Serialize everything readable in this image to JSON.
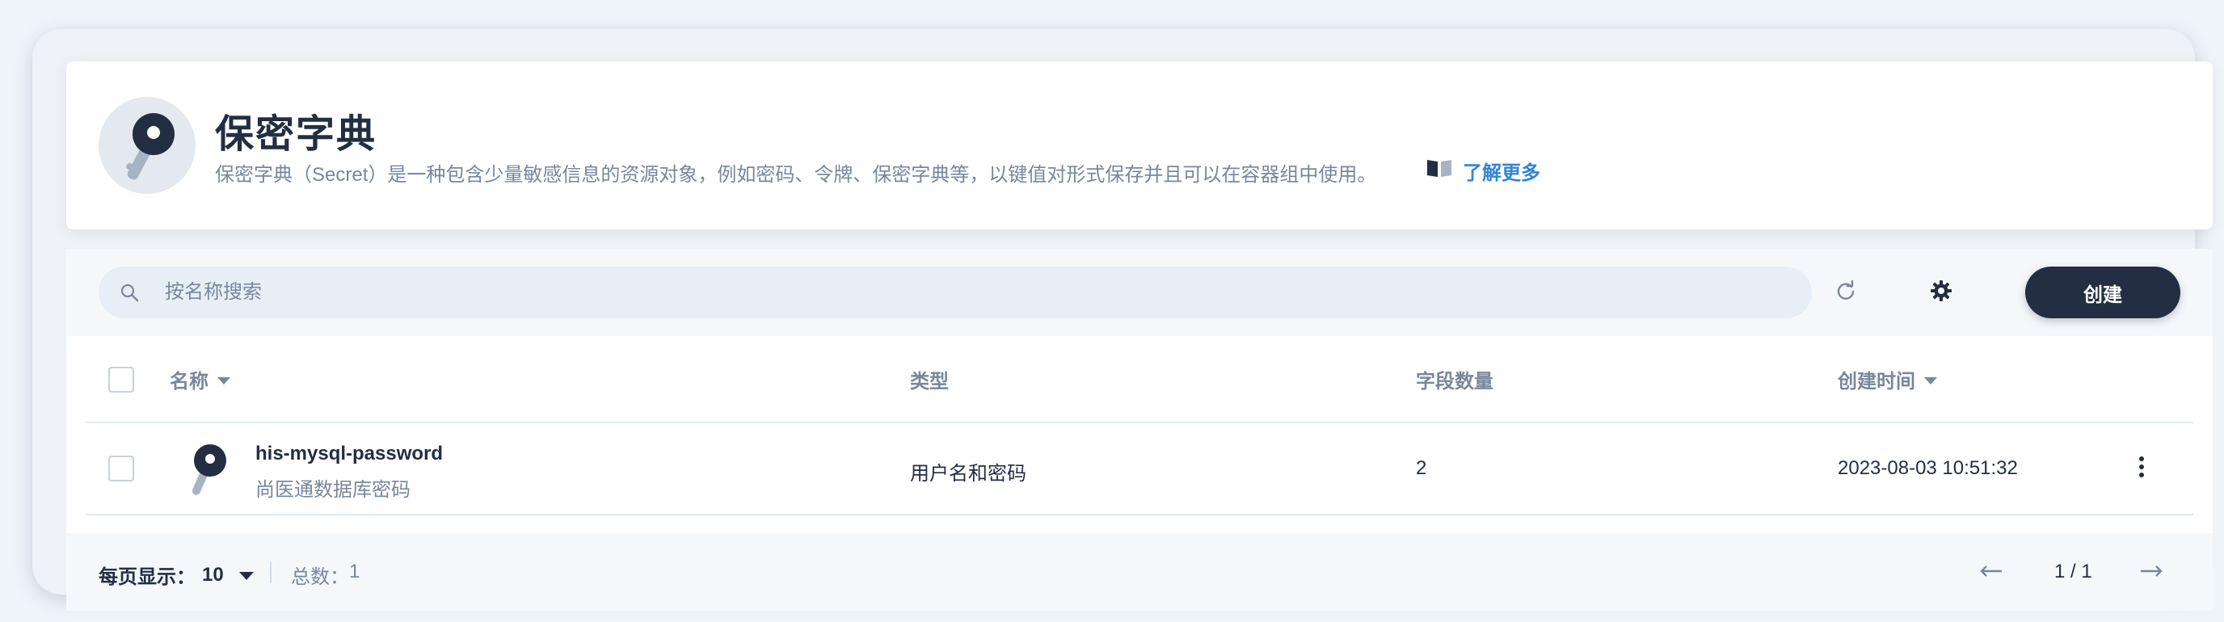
{
  "header": {
    "title": "保密字典",
    "description": "保密字典（Secret）是一种包含少量敏感信息的资源对象，例如密码、令牌、保密字典等，以键值对形式保存并且可以在容器组中使用。",
    "learn_more": "了解更多"
  },
  "toolbar": {
    "search_placeholder": "按名称搜索",
    "create_label": "创建"
  },
  "table": {
    "columns": {
      "name": "名称",
      "type": "类型",
      "field_count": "字段数量",
      "created_time": "创建时间"
    },
    "rows": [
      {
        "name": "his-mysql-password",
        "description": "尚医通数据库密码",
        "type": "用户名和密码",
        "field_count": "2",
        "created_time": "2023-08-03 10:51:32"
      }
    ]
  },
  "footer": {
    "per_page_label": "每页显示：",
    "per_page_value": "10",
    "total_label": "总数：",
    "total_value": "1",
    "page_indicator": "1 / 1"
  },
  "colors": {
    "primary_dark": "#242e42",
    "link": "#3385d6",
    "muted": "#79879c",
    "icon_accent": "#a7b4c3"
  },
  "icons": {
    "header": "key-icon",
    "search": "search-icon",
    "refresh": "refresh-icon",
    "settings": "gear-icon",
    "learn_more": "book-icon",
    "row": "key-icon",
    "more": "more-vertical-icon",
    "prev": "arrow-left-icon",
    "next": "arrow-right-icon",
    "sort": "caret-down-icon"
  }
}
